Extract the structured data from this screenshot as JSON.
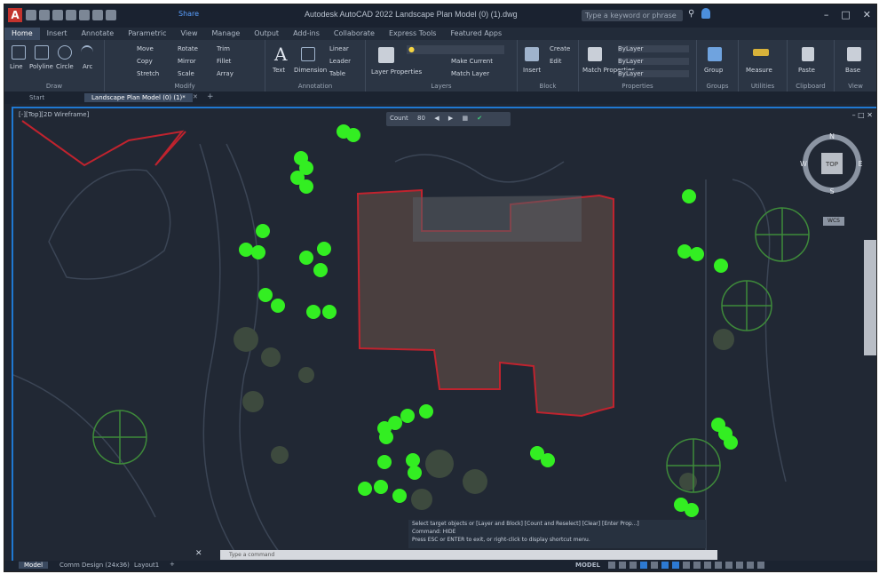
{
  "app": {
    "logo": "A",
    "title": "Autodesk AutoCAD 2022   Landscape Plan Model (0) (1).dwg",
    "search_placeholder": "Type a keyword or phrase"
  },
  "quick_access": {
    "share_label": "Share"
  },
  "ribbon_tabs": [
    "Home",
    "Insert",
    "Annotate",
    "Parametric",
    "View",
    "Manage",
    "Output",
    "Add-ins",
    "Collaborate",
    "Express Tools",
    "Featured Apps"
  ],
  "ribbon": {
    "draw": {
      "label": "Draw",
      "buttons": [
        "Line",
        "Polyline",
        "Circle",
        "Arc"
      ]
    },
    "modify": {
      "label": "Modify",
      "buttons": [
        "Move",
        "Rotate",
        "Trim",
        "Copy",
        "Mirror",
        "Fillet",
        "Stretch",
        "Scale",
        "Array"
      ]
    },
    "annotation": {
      "label": "Annotation",
      "buttons": [
        "Text",
        "Dimension",
        "Linear",
        "Leader",
        "Table"
      ]
    },
    "layers": {
      "label": "Layers",
      "buttons": [
        "Layer Properties",
        "Make Current",
        "Match Layer"
      ]
    },
    "block": {
      "label": "Block",
      "buttons": [
        "Insert",
        "Create",
        "Edit"
      ]
    },
    "properties": {
      "label": "Properties",
      "buttons": [
        "Match Properties",
        "ByLayer",
        "ByLayer",
        "ByLayer"
      ]
    },
    "groups": {
      "label": "Groups",
      "buttons": [
        "Group"
      ]
    },
    "utilities": {
      "label": "Utilities",
      "buttons": [
        "Measure"
      ]
    },
    "clipboard": {
      "label": "Clipboard",
      "buttons": [
        "Paste"
      ]
    },
    "view": {
      "label": "View",
      "buttons": [
        "Base"
      ]
    }
  },
  "doc_tabs": [
    "Start",
    "Landscape Plan Model (0) (1)*"
  ],
  "viewport": {
    "label": "[-][Top][2D Wireframe]",
    "edit_toolbar_label": "Count",
    "edit_toolbar_value": "80",
    "viewcube": {
      "face": "TOP",
      "north": "N",
      "south": "S",
      "east": "E",
      "west": "W",
      "wcs": "WCS"
    }
  },
  "command": {
    "history": [
      "Select target objects or [Layer and Block] [Count and Reselect] [Clear] [Enter Prop...]",
      "Command: HIDE",
      "Press ESC or ENTER to exit, or right-click to display shortcut menu."
    ],
    "placeholder": "Type a command"
  },
  "status": {
    "layouts": [
      "Model",
      "Comm Design (24x36)",
      "Layout1"
    ],
    "mode": "MODEL"
  },
  "colors": {
    "accent": "#1f78d1",
    "highlight": "#33ff33",
    "building": "#c0232e",
    "background": "#212834"
  }
}
